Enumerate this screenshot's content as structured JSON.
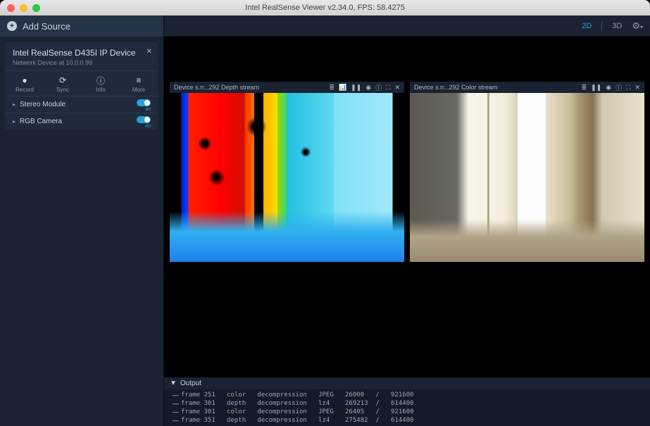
{
  "window": {
    "title": "Intel RealSense Viewer v2.34.0, FPS: 58.4275"
  },
  "sidebar": {
    "add_source": "Add Source",
    "device": {
      "title": "Intel RealSense D435I IP Device",
      "subtitle": "Network Device at 10.0.0.99",
      "tools": [
        {
          "id": "record",
          "label": "Record"
        },
        {
          "id": "sync",
          "label": "Sync"
        },
        {
          "id": "info",
          "label": "Info"
        },
        {
          "id": "more",
          "label": "More"
        }
      ],
      "streams": [
        {
          "label": "Stereo Module",
          "state": "on"
        },
        {
          "label": "RGB Camera",
          "state": "on"
        }
      ]
    }
  },
  "topbar": {
    "view2d": "2D",
    "view3d": "3D"
  },
  "streams": {
    "depth": {
      "header": "Device s.n:..292 Depth stream"
    },
    "color": {
      "header": "Device s.n:..292 Color stream"
    }
  },
  "output": {
    "title": "Output",
    "rows": [
      {
        "frame": "frame 251",
        "kind": "color",
        "op": "decompression",
        "codec": "JPEG",
        "a": "26000",
        "b": "921600"
      },
      {
        "frame": "frame 301",
        "kind": "depth",
        "op": "decompression",
        "codec": "lz4",
        "a": "269213",
        "b": "614400"
      },
      {
        "frame": "frame 301",
        "kind": "color",
        "op": "decompression",
        "codec": "JPEG",
        "a": "26405",
        "b": "921600"
      },
      {
        "frame": "frame 351",
        "kind": "depth",
        "op": "decompression",
        "codec": "lz4",
        "a": "275482",
        "b": "614400"
      }
    ]
  }
}
